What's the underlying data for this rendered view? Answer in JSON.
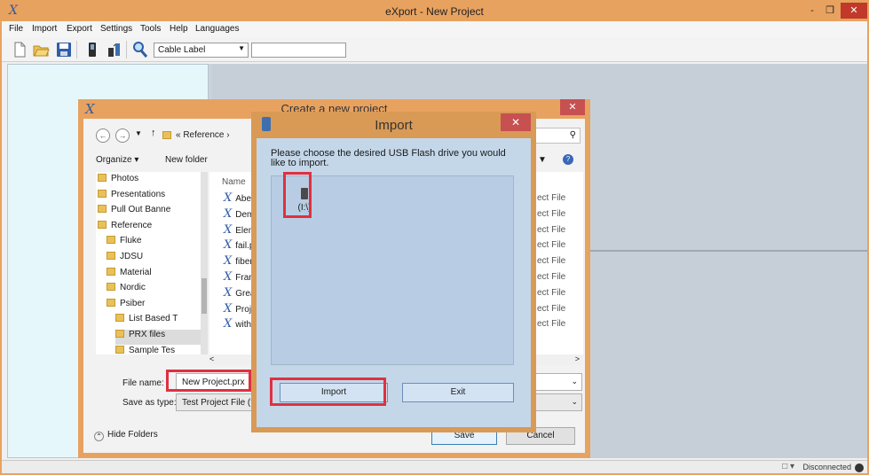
{
  "app": {
    "icon_glyph": "X",
    "title": "eXport - New Project",
    "controls": {
      "minimize": "-",
      "restore": "❒",
      "close": "✕"
    }
  },
  "menu": [
    "File",
    "Import",
    "Export",
    "Settings",
    "Tools",
    "Help",
    "Languages"
  ],
  "toolbar": {
    "cable_select_value": "Cable Label",
    "search_value": ""
  },
  "status": {
    "text": "Disconnected",
    "glyph": "□ ▾"
  },
  "create_dialog": {
    "title": "Create a new project",
    "address": "« Reference ›",
    "organize": "Organize ▾",
    "new_folder": "New folder",
    "tree": [
      {
        "label": "Photos",
        "indent": 0,
        "selected": false
      },
      {
        "label": "Presentations",
        "indent": 0,
        "selected": false
      },
      {
        "label": "Pull Out Banne",
        "indent": 0,
        "selected": false
      },
      {
        "label": "Reference",
        "indent": 0,
        "selected": false
      },
      {
        "label": "Fluke",
        "indent": 1,
        "selected": false
      },
      {
        "label": "JDSU",
        "indent": 1,
        "selected": false
      },
      {
        "label": "Material",
        "indent": 1,
        "selected": false
      },
      {
        "label": "Nordic",
        "indent": 1,
        "selected": false
      },
      {
        "label": "Psiber",
        "indent": 1,
        "selected": false
      },
      {
        "label": "List Based T",
        "indent": 2,
        "selected": false
      },
      {
        "label": "PRX files",
        "indent": 2,
        "selected": true
      },
      {
        "label": "Sample Tes",
        "indent": 2,
        "selected": false
      }
    ],
    "files_header": "Name",
    "files": [
      "Abe",
      "Dem",
      "Elem",
      "fail.p",
      "fiber",
      "Fran",
      "Grea",
      "Proj",
      "with"
    ],
    "file_types": [
      "ect File",
      "ect File",
      "ect File",
      "ect File",
      "ect File",
      "ect File",
      "ect File",
      "ect File",
      "ect File"
    ],
    "file_name_label": "File name:",
    "file_name_value": "New Project.prx",
    "save_type_label": "Save as type:",
    "save_type_value": "Test Project File (*",
    "hide_folders": "Hide Folders",
    "save_btn": "Save",
    "cancel_btn": "Cancel"
  },
  "import_dialog": {
    "title": "Import",
    "prompt": "Please choose the desired USB Flash drive you would like to import.",
    "drive_label": "(I:\\)",
    "import_btn": "Import",
    "exit_btn": "Exit"
  }
}
